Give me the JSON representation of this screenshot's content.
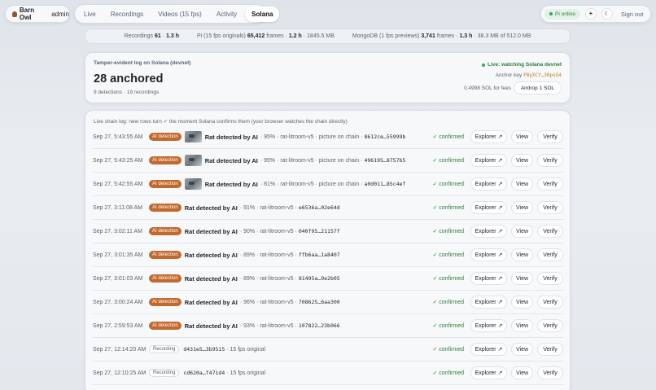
{
  "brand": {
    "name": "Barn Owl",
    "role": "admin",
    "icon": "owl-icon"
  },
  "nav": {
    "tabs": [
      "Live",
      "Recordings",
      "Videos (15 fps)",
      "Activity",
      "Solana"
    ],
    "active": "Solana"
  },
  "status": {
    "pi": "Pi online",
    "sun_glyph": "☀",
    "moon_glyph": "☾",
    "sign_out": "Sign out"
  },
  "stats": {
    "recordings_label": "Recordings",
    "recordings_count": "61",
    "recordings_size": "1.3 h",
    "pi_label": "Pi (15 fps originals)",
    "pi_frames": "65,412",
    "pi_frames_label": "frames ·",
    "pi_hours": "1.2 h",
    "pi_size": "1845.5 MB",
    "mongo_label": "MongoDB (1 fps previews)",
    "mongo_frames": "3,741",
    "mongo_frames_label": "frames ·",
    "mongo_hours": "1.3 h",
    "mongo_size": "38.3 MB of 512.0 MB"
  },
  "anchor": {
    "label": "Tamper-evident log on Solana (devnet)",
    "count": "28 anchored",
    "sub": "9 detections · 19 recordings",
    "live": "Live: watching Solana devnet",
    "key_label": "Anchor key",
    "key": "FByXCY…30psG4",
    "sol": "0.4998 SOL for fees",
    "airdrop": "Airdrop 1 SOL"
  },
  "log": {
    "title": "Live chain log: new rows turn ✓ the moment Solana confirms them (your browser watches the chain directly)",
    "confirmed": "✓ confirmed",
    "explorer": "Explorer ↗",
    "view": "View",
    "verify": "Verify",
    "rows": [
      {
        "time": "Sep 27, 5:43:55 AM",
        "badge": "AI detection",
        "thumb": true,
        "title": "Rat detected by AI",
        "meta": "· 95% · rat-litroom-v5 · picture on chain ·",
        "hash": "8612ce…55999b"
      },
      {
        "time": "Sep 27, 5:43:25 AM",
        "badge": "AI detection",
        "thumb": true,
        "title": "Rat detected by AI",
        "meta": "· 95% · rat-litroom-v5 · picture on chain ·",
        "hash": "496195…8757b5"
      },
      {
        "time": "Sep 27, 5:42:55 AM",
        "badge": "AI detection",
        "thumb": true,
        "title": "Rat detected by AI",
        "meta": "· 81% · rat-litroom-v5 · picture on chain ·",
        "hash": "a0d011…85c4ef"
      },
      {
        "time": "Sep 27, 3:11:08 AM",
        "badge": "AI detection",
        "thumb": false,
        "title": "Rat detected by AI",
        "meta": "· 91% · rat-litroom-v5 ·",
        "hash": "e6536a…02e64d"
      },
      {
        "time": "Sep 27, 3:02:11 AM",
        "badge": "AI detection",
        "thumb": false,
        "title": "Rat detected by AI",
        "meta": "· 90% · rat-litroom-v5 ·",
        "hash": "040f95…21157f"
      },
      {
        "time": "Sep 27, 3:01:35 AM",
        "badge": "AI detection",
        "thumb": false,
        "title": "Rat detected by AI",
        "meta": "· 89% · rat-litroom-v5 ·",
        "hash": "ffb6aa…1a8407"
      },
      {
        "time": "Sep 27, 3:01:03 AM",
        "badge": "AI detection",
        "thumb": false,
        "title": "Rat detected by AI",
        "meta": "· 89% · rat-litroom-v5 ·",
        "hash": "81495a…9e2b05"
      },
      {
        "time": "Sep 27, 3:00:24 AM",
        "badge": "AI detection",
        "thumb": false,
        "title": "Rat detected by AI",
        "meta": "· 96% · rat-litroom-v5 ·",
        "hash": "708625…6aa300"
      },
      {
        "time": "Sep 27, 2:59:53 AM",
        "badge": "AI detection",
        "thumb": false,
        "title": "Rat detected by AI",
        "meta": "· 93% · rat-litroom-v5 ·",
        "hash": "107822…23b066"
      },
      {
        "time": "Sep 27, 12:14:20 AM",
        "badge": "Recording",
        "thumb": false,
        "title": "",
        "meta": "· 15 fps original",
        "hash": "d431e5…3b9515"
      },
      {
        "time": "Sep 27, 12:10:25 AM",
        "badge": "Recording",
        "thumb": false,
        "title": "",
        "meta": "· 15 fps original",
        "hash": "cd620a…f471d4"
      }
    ]
  },
  "colors": {
    "ai_badge": "#c2692e",
    "confirmed": "#2e7d3c",
    "anchor_key": "#c47a1e",
    "live": "#34a853"
  }
}
